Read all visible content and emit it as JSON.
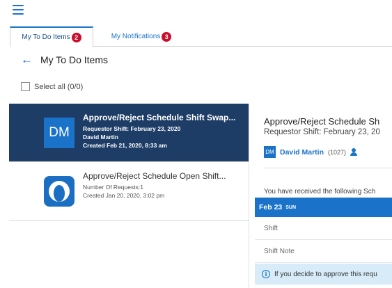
{
  "header": {
    "menu_icon": "hamburger-menu-icon"
  },
  "tabs": [
    {
      "label": "My To Do Items",
      "badge": "2",
      "active": true
    },
    {
      "label": "My Notifications",
      "badge": "3",
      "active": false
    }
  ],
  "page": {
    "back_icon": "arrow-left-icon",
    "title": "My To Do Items",
    "select_all_label": "Select all (0/0)"
  },
  "list": {
    "items": [
      {
        "avatar_text": "DM",
        "title": "Approve/Reject Schedule Shift Swap...",
        "lines": [
          "Requestor Shift: February 23, 2020",
          "David Martin",
          "Created Feb 21, 2020, 8:33 am"
        ],
        "selected": true
      },
      {
        "avatar_icon": "app-logo-icon",
        "title": "Approve/Reject Schedule Open Shift...",
        "lines": [
          "Number Of Requests:1",
          "Created Jan 20, 2020, 3:02 pm"
        ],
        "selected": false
      }
    ]
  },
  "detail": {
    "title": "Approve/Reject Schedule Sh",
    "subtitle": "Requestor Shift: February 23, 20",
    "user": {
      "avatar_text": "DM",
      "name": "David Martin",
      "id": "(1027)",
      "icon": "user-profile-icon"
    },
    "received_text": "You have received the following Sch",
    "date": "Feb 23",
    "day_of_week": "SUN",
    "fields": [
      "Shift",
      "Shift Note"
    ],
    "info_icon": "info-icon",
    "info_text": "If you decide to approve this requ"
  },
  "colors": {
    "accent": "#1a73c8",
    "selected_row": "#1d3d66",
    "badge": "#c8102e",
    "info_bg": "#d8ebf9"
  }
}
